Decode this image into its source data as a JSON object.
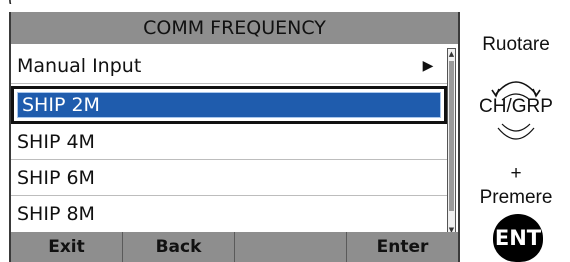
{
  "top_fragment": "( ",
  "screen": {
    "title": "COMM FREQUENCY",
    "items": [
      {
        "label": "Manual Input",
        "has_submenu": true,
        "selected": false
      },
      {
        "label": "SHIP 2M",
        "has_submenu": false,
        "selected": true
      },
      {
        "label": "SHIP 4M",
        "has_submenu": false,
        "selected": false
      },
      {
        "label": "SHIP 6M",
        "has_submenu": false,
        "selected": false
      },
      {
        "label": "SHIP 8M",
        "has_submenu": false,
        "selected": false
      }
    ],
    "softkeys": [
      "Exit",
      "Back",
      "",
      "Enter"
    ]
  },
  "instructions": {
    "rotate": "Ruotare",
    "knob_label": "CH/GRP",
    "plus": "+",
    "press": "Premere",
    "ent_key": "ENT"
  },
  "colors": {
    "bar_gray": "#8e8e8e",
    "selection_blue": "#1f5cad"
  },
  "icons": {
    "submenu": "right-triangle-icon",
    "knob": "rotary-knob-icon",
    "scroll_up": "scroll-up-arrow-icon",
    "scroll_down": "scroll-down-arrow-icon"
  }
}
